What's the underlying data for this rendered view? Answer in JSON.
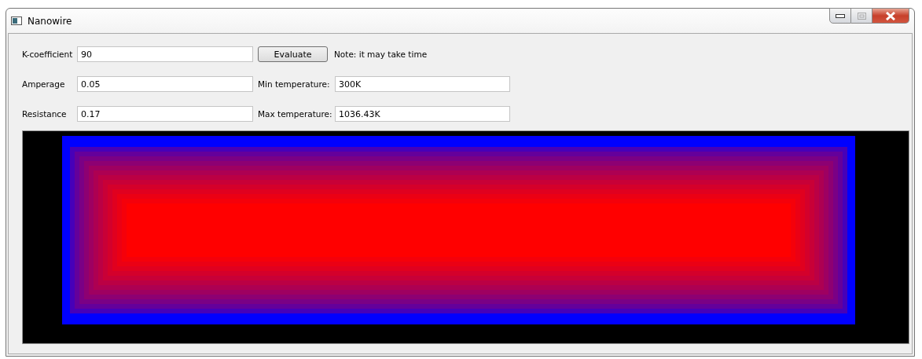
{
  "window": {
    "title": "Nanowire"
  },
  "form": {
    "k_coefficient": {
      "label": "K-coefficient",
      "value": "90"
    },
    "evaluate_button": "Evaluate",
    "note": "Note: it may take time",
    "amperage": {
      "label": "Amperage",
      "value": "0.05"
    },
    "min_temperature": {
      "label": "Min temperature:",
      "value": "300K"
    },
    "resistance": {
      "label": "Resistance",
      "value": "0.17"
    },
    "max_temperature": {
      "label": "Max temperature:",
      "value": "1036.43K"
    }
  }
}
